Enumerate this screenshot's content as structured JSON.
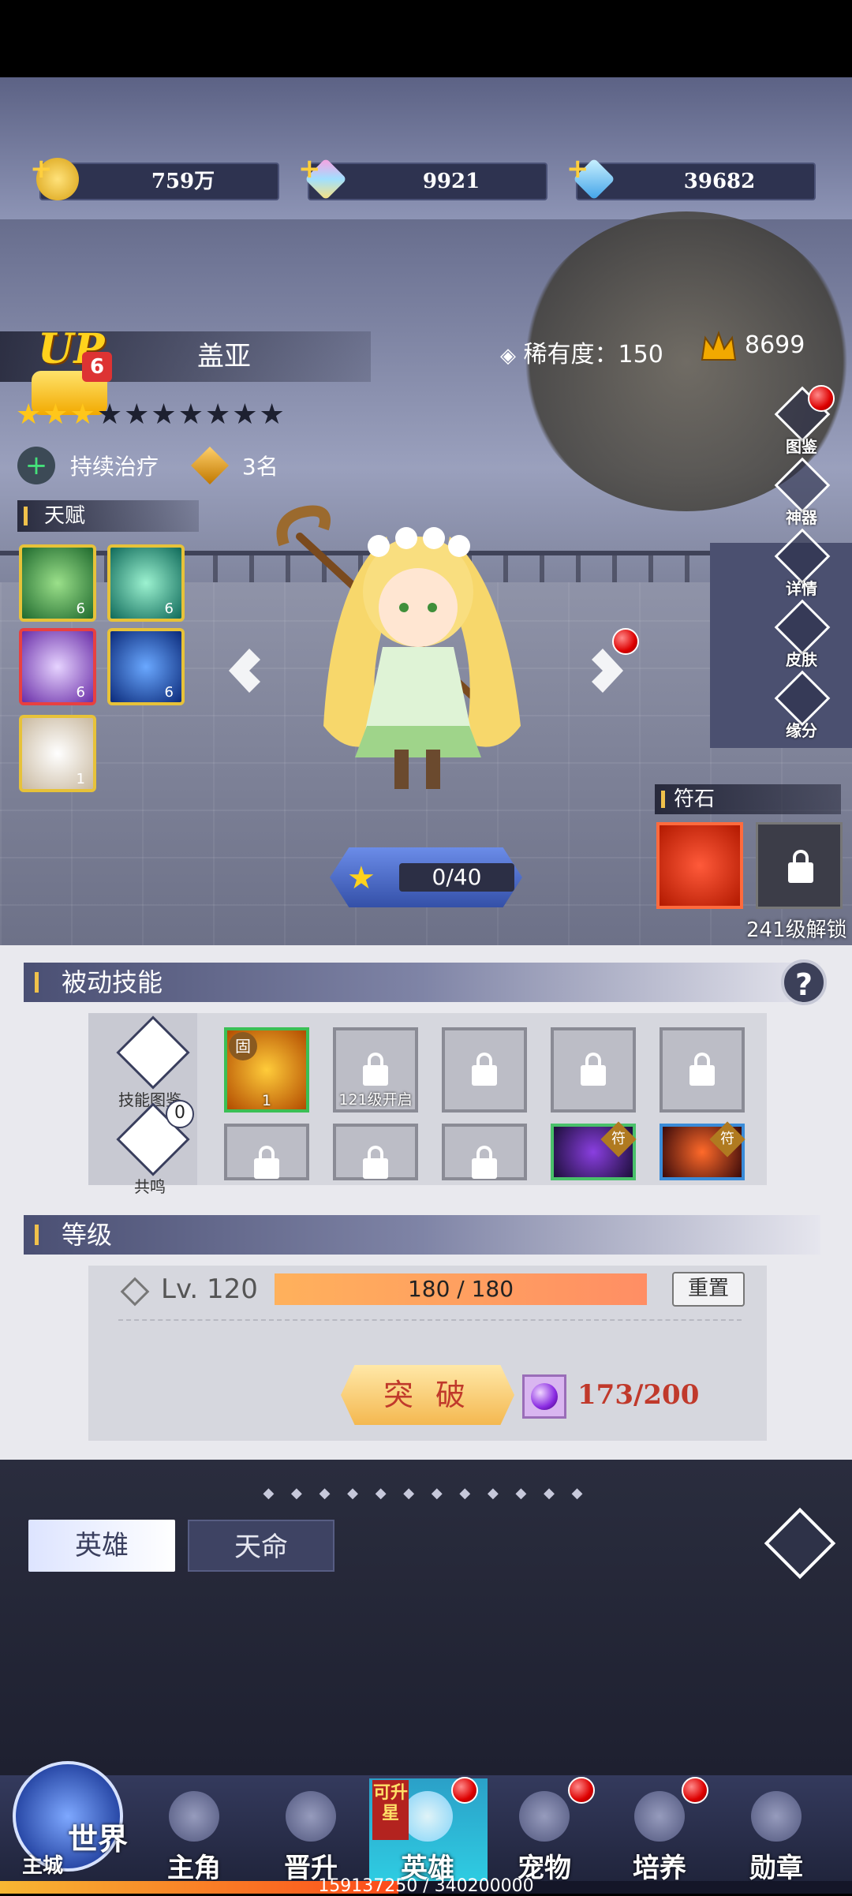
{
  "currency": [
    {
      "icon": "gold-coin-icon",
      "value": "759万"
    },
    {
      "icon": "rainbow-crystal-icon",
      "value": "9921"
    },
    {
      "icon": "blue-diamond-icon",
      "value": "39682"
    }
  ],
  "hero": {
    "name": "盖亚",
    "up_label": "UP",
    "up_count": "6",
    "stars_filled": 3,
    "stars_total": 10,
    "rarity": "稀有度：150",
    "power": "8699",
    "skill_tag": "持续治疗",
    "rank": "3名"
  },
  "side_buttons": [
    {
      "label": "图鉴",
      "has_red_dot": true
    },
    {
      "label": "神器",
      "has_red_dot": false
    },
    {
      "label": "详情",
      "has_red_dot": false
    },
    {
      "label": "皮肤",
      "has_red_dot": false
    },
    {
      "label": "缘分",
      "has_red_dot": false
    }
  ],
  "talents": {
    "title": "天赋",
    "items": [
      {
        "icon": "wind-swirl-icon",
        "level": "6"
      },
      {
        "icon": "green-cross-icon",
        "level": "6"
      },
      {
        "icon": "purple-slash-icon",
        "level": "6"
      },
      {
        "icon": "lightning-icon",
        "level": "6"
      },
      {
        "icon": "flower-wreath-icon",
        "level": "1"
      }
    ]
  },
  "rune": {
    "title": "符石",
    "unlock_text": "241级解锁"
  },
  "exp": {
    "value": "0/40"
  },
  "passive": {
    "title": "被动技能",
    "left_buttons": [
      {
        "label": "技能图鉴",
        "icon": "book-icon"
      },
      {
        "label": "共鸣",
        "icon": "resonance-icon",
        "count": "0"
      }
    ],
    "slots": [
      {
        "type": "skill",
        "icon": "golden-orb-icon",
        "badge": "固",
        "level": "1"
      },
      {
        "type": "locked",
        "caption": "121级开启"
      },
      {
        "type": "locked",
        "caption": ""
      },
      {
        "type": "locked",
        "caption": ""
      },
      {
        "type": "locked",
        "caption": ""
      },
      {
        "type": "locked",
        "caption": ""
      },
      {
        "type": "locked",
        "caption": ""
      },
      {
        "type": "locked",
        "caption": ""
      },
      {
        "type": "skill",
        "icon": "purple-figure-icon",
        "badge": "符"
      },
      {
        "type": "skill",
        "icon": "red-beast-icon",
        "badge": "符"
      }
    ]
  },
  "level": {
    "title": "等级",
    "lv_text": "Lv. 120",
    "progress": "180 / 180",
    "progress_fraction": 1.0,
    "reset_label": "重置",
    "breakthrough_label": "突 破",
    "material_count": "173/200"
  },
  "tabs": [
    {
      "label": "英雄",
      "active": true
    },
    {
      "label": "天命",
      "active": false
    }
  ],
  "nav": {
    "world_label": "世界",
    "world_sub": "主城",
    "items": [
      {
        "label": "主角",
        "icon": "knight-icon",
        "red_dot": false,
        "active": false
      },
      {
        "label": "晋升",
        "icon": "wings-icon",
        "red_dot": false,
        "active": false
      },
      {
        "label": "英雄",
        "icon": "helmet-icon",
        "red_dot": true,
        "active": true,
        "tag": "可升星"
      },
      {
        "label": "宠物",
        "icon": "beast-icon",
        "red_dot": true,
        "active": false
      },
      {
        "label": "培养",
        "icon": "gem-icon",
        "red_dot": true,
        "active": false
      },
      {
        "label": "勋章",
        "icon": "medal-icon",
        "red_dot": false,
        "active": false
      }
    ],
    "xp_text": "159137250 / 340200000",
    "xp_fraction": 0.4678
  },
  "colors": {
    "accent_gold": "#f0c14b",
    "active_tab": "#2fd1e5",
    "red_text": "#c0392b"
  }
}
